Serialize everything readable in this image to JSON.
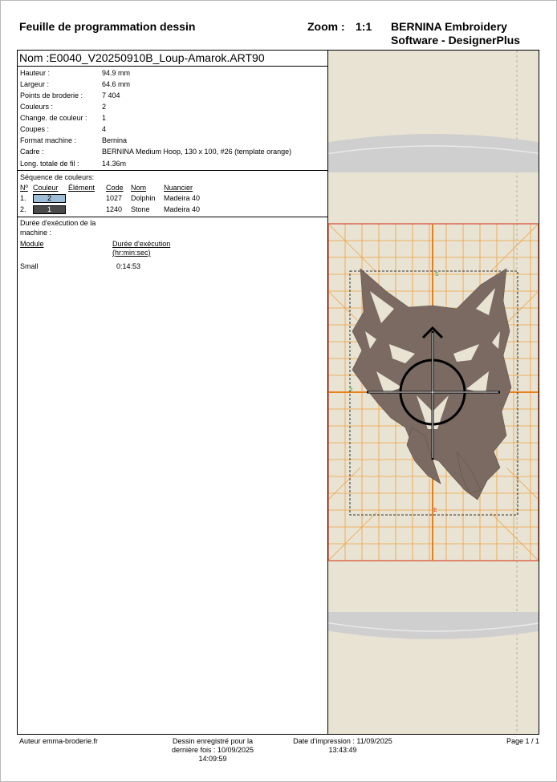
{
  "header": {
    "title": "Feuille de programmation dessin",
    "zoom_label": "Zoom :",
    "zoom_value": "1:1",
    "software_line1": "BERNINA Embroidery",
    "software_line2": "Software - DesignerPlus"
  },
  "design": {
    "name": "Nom  :E0040_V20250910B_Loup-Amarok.ART90",
    "properties": [
      {
        "label": "Hauteur :",
        "value": "94.9 mm"
      },
      {
        "label": "Largeur :",
        "value": "64.6 mm"
      },
      {
        "label": "Points de broderie :",
        "value": "7 404"
      },
      {
        "label": "Couleurs :",
        "value": "2"
      },
      {
        "label": "Change. de couleur :",
        "value": "1"
      },
      {
        "label": "Coupes :",
        "value": "4"
      },
      {
        "label": "Format machine :",
        "value": "Bernina"
      },
      {
        "label": "Cadre :",
        "value": "BERNINA Medium Hoop, 130 x 100, #26 (template orange)"
      },
      {
        "label": "Long. totale de fil :",
        "value": "14.36m"
      }
    ]
  },
  "colors": {
    "title": "Séquence de couleurs:",
    "headers": {
      "n": "Nº",
      "couleur": "Couleur",
      "element": "Élément",
      "code": "Code",
      "nom": "Nom",
      "nuancier": "Nuancier"
    },
    "rows": [
      {
        "n": "1.",
        "swatch_label": "2",
        "swatch_color": "#9ebed8",
        "swatch_text": "#000000",
        "code": "1027",
        "nom": "Dolphin",
        "nuancier": "Madeira 40"
      },
      {
        "n": "2.",
        "swatch_label": "1",
        "swatch_color": "#4a4a4a",
        "swatch_text": "#ffffff",
        "code": "1240",
        "nom": "Stone",
        "nuancier": "Madeira 40"
      }
    ]
  },
  "duration": {
    "title_line1": "Durée d'exécution de la",
    "title_line2": "machine :",
    "col_module": "Module",
    "col_duration1": "Durée d'exécution",
    "col_duration2": "(hr:min:sec)",
    "rows": [
      {
        "module": "Small",
        "time": "0:14:53"
      }
    ]
  },
  "footer": {
    "author": "Auteur emma-broderie.fr",
    "saved_line1": "Dessin enregistré pour la",
    "saved_line2": "dernière fois : 10/09/2025",
    "saved_line3": "14:09:59",
    "print_line1": "Date d'impression : 11/09/2025",
    "print_line2": "13:43:49",
    "page": "Page 1 / 1"
  },
  "preview": {
    "background_color": "#e8e3d3",
    "hoop_color": "#cfcfcf",
    "grid_color": "#f0a040",
    "hoop_border_color": "#d94a30",
    "axis_color": "#e8801a",
    "embroidery_color": "#7a6a62",
    "icons": [
      "hoop-template-icon",
      "wolf-embroidery-icon",
      "crosshair-icon"
    ]
  }
}
